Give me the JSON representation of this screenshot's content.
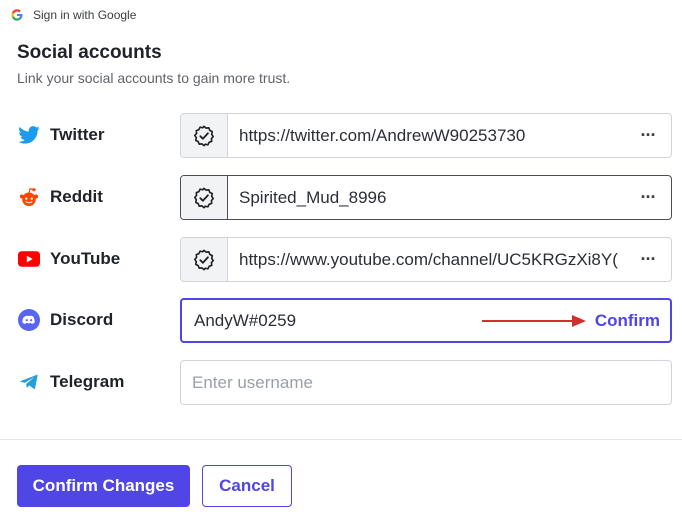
{
  "topbar": {
    "text": "Sign in with Google",
    "icon": "google-icon"
  },
  "header": {
    "title": "Social accounts",
    "subtitle": "Link your social accounts to gain more trust."
  },
  "colors": {
    "accent": "#4f46e5",
    "twitter": "#1d9bf0",
    "reddit": "#ff4500",
    "youtube": "#ff0000",
    "discord": "#5865f2",
    "telegram": "#229ed9",
    "arrow": "#d32f2f"
  },
  "accounts": [
    {
      "label": "Twitter",
      "icon": "twitter-icon",
      "value": "https://twitter.com/AndrewW90253730",
      "verified": true
    },
    {
      "label": "Reddit",
      "icon": "reddit-icon",
      "value": "Spirited_Mud_8996",
      "verified": true
    },
    {
      "label": "YouTube",
      "icon": "youtube-icon",
      "value": "https://www.youtube.com/channel/UC5KRGzXi8Y(",
      "verified": true
    },
    {
      "label": "Discord",
      "icon": "discord-icon",
      "value": "AndyW#0259",
      "action": "Confirm"
    },
    {
      "label": "Telegram",
      "icon": "telegram-icon",
      "value": "",
      "placeholder": "Enter username"
    }
  ],
  "more_label": "···",
  "buttons": {
    "confirm_changes": "Confirm Changes",
    "cancel": "Cancel"
  }
}
